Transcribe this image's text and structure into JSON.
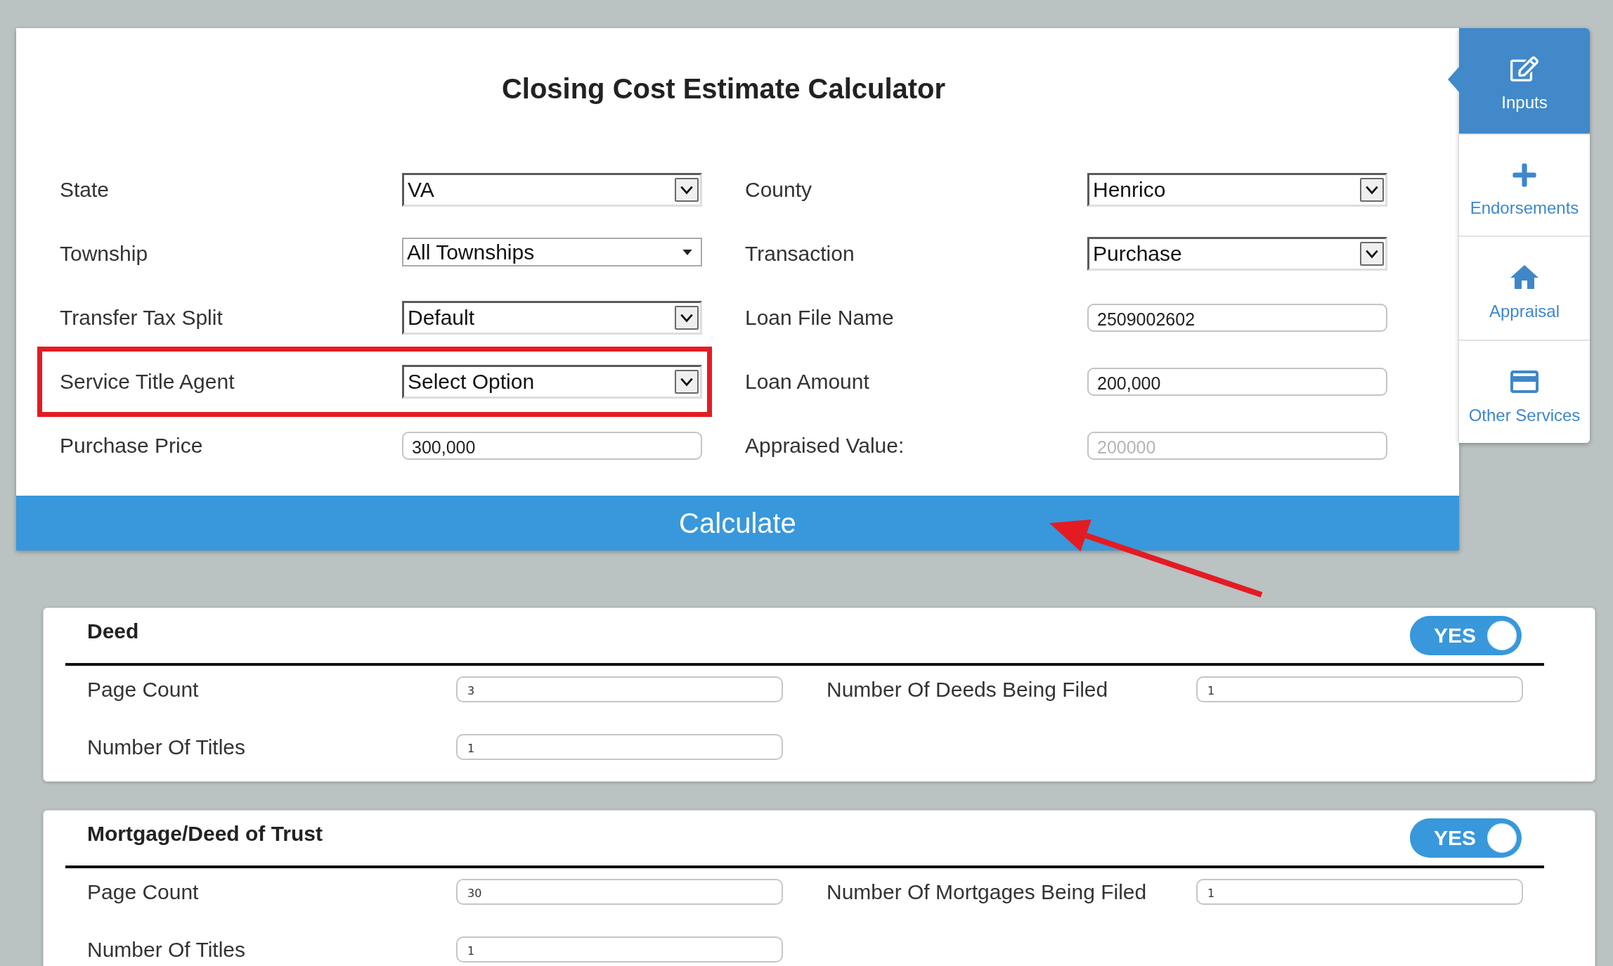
{
  "title": "Closing Cost Estimate Calculator",
  "form": {
    "left": [
      {
        "label": "State",
        "kind": "select",
        "value": "VA",
        "highlighted": false
      },
      {
        "label": "Township",
        "kind": "dropdown",
        "value": "All Townships",
        "highlighted": false
      },
      {
        "label": "Transfer Tax Split",
        "kind": "select",
        "value": "Default",
        "highlighted": false
      },
      {
        "label": "Service Title Agent",
        "kind": "select",
        "value": "Select Option",
        "highlighted": true
      },
      {
        "label": "Purchase Price",
        "kind": "input",
        "value": "300,000",
        "highlighted": false
      }
    ],
    "right": [
      {
        "label": "County",
        "kind": "select",
        "value": "Henrico",
        "highlighted": false
      },
      {
        "label": "Transaction",
        "kind": "select",
        "value": "Purchase",
        "highlighted": false
      },
      {
        "label": "Loan File Name",
        "kind": "input",
        "value": "2509002602",
        "highlighted": false
      },
      {
        "label": "Loan Amount",
        "kind": "input",
        "value": "200,000",
        "highlighted": false
      },
      {
        "label": "Appraised Value:",
        "kind": "input",
        "placeholder": "200000",
        "highlighted": false
      }
    ]
  },
  "calculate_button": {
    "label": "Calculate",
    "annotated": true
  },
  "sidebar": {
    "items": [
      {
        "label": "Inputs",
        "selected": true
      },
      {
        "label": "Endorsements",
        "selected": false
      },
      {
        "label": "Appraisal",
        "selected": false
      },
      {
        "label": "Other Services",
        "selected": false
      }
    ]
  },
  "sections": [
    {
      "title": "Deed",
      "toggle": {
        "label": "YES",
        "on": true
      },
      "rows": [
        {
          "fields": [
            {
              "label": "Page Count",
              "value": "3"
            },
            {
              "label": "Number Of Deeds Being Filed",
              "value": "1"
            }
          ]
        },
        {
          "fields": [
            {
              "label": "Number Of Titles",
              "value": "1"
            }
          ]
        }
      ]
    },
    {
      "title": "Mortgage/Deed of Trust",
      "toggle": {
        "label": "YES",
        "on": true
      },
      "rows": [
        {
          "fields": [
            {
              "label": "Page Count",
              "value": "30"
            },
            {
              "label": "Number Of Mortgages Being Filed",
              "value": "1"
            }
          ]
        },
        {
          "fields": [
            {
              "label": "Number Of Titles",
              "value": "1"
            }
          ]
        }
      ]
    }
  ]
}
